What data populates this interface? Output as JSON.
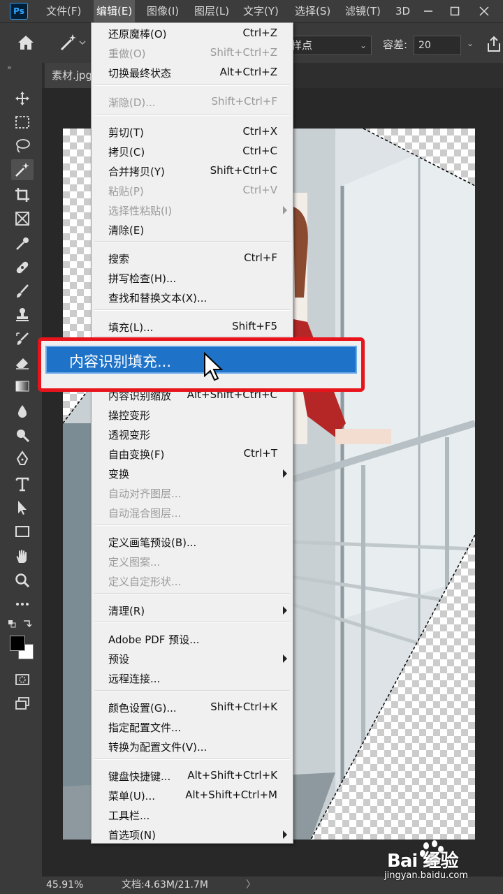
{
  "menubar": {
    "logo": "Ps",
    "items": [
      {
        "label": "文件(F)"
      },
      {
        "label": "编辑(E)"
      },
      {
        "label": "图像(I)"
      },
      {
        "label": "图层(L)"
      },
      {
        "label": "文字(Y)"
      },
      {
        "label": "选择(S)"
      },
      {
        "label": "滤镜(T)"
      },
      {
        "label": "3D"
      }
    ]
  },
  "options": {
    "sample_value": "样点",
    "tolerance_label": "容差:",
    "tolerance_value": "20"
  },
  "document": {
    "tab_label": "素材.jpg"
  },
  "edit_menu": {
    "items": [
      {
        "label": "还原魔棒(O)",
        "shortcut": "Ctrl+Z",
        "disabled": false
      },
      {
        "label": "重做(O)",
        "shortcut": "Shift+Ctrl+Z",
        "disabled": true
      },
      {
        "label": "切换最终状态",
        "shortcut": "Alt+Ctrl+Z",
        "disabled": false
      },
      {
        "label": "渐隐(D)...",
        "shortcut": "Shift+Ctrl+F",
        "disabled": true
      },
      {
        "label": "剪切(T)",
        "shortcut": "Ctrl+X",
        "disabled": false
      },
      {
        "label": "拷贝(C)",
        "shortcut": "Ctrl+C",
        "disabled": false
      },
      {
        "label": "合并拷贝(Y)",
        "shortcut": "Shift+Ctrl+C",
        "disabled": false
      },
      {
        "label": "粘贴(P)",
        "shortcut": "Ctrl+V",
        "disabled": true
      },
      {
        "label": "选择性粘贴(I)",
        "shortcut": "",
        "disabled": true,
        "submenu": true
      },
      {
        "label": "清除(E)",
        "shortcut": "",
        "disabled": false
      },
      {
        "label": "搜索",
        "shortcut": "Ctrl+F",
        "disabled": false
      },
      {
        "label": "拼写检查(H)...",
        "shortcut": "",
        "disabled": false
      },
      {
        "label": "查找和替换文本(X)...",
        "shortcut": "",
        "disabled": false
      },
      {
        "label": "填充(L)...",
        "shortcut": "Shift+F5",
        "disabled": false
      },
      {
        "label": "内容识别缩放",
        "shortcut": "Alt+Shift+Ctrl+C",
        "disabled": false
      },
      {
        "label": "操控变形",
        "shortcut": "",
        "disabled": false
      },
      {
        "label": "透视变形",
        "shortcut": "",
        "disabled": false
      },
      {
        "label": "自由变换(F)",
        "shortcut": "Ctrl+T",
        "disabled": false
      },
      {
        "label": "变换",
        "shortcut": "",
        "disabled": false,
        "submenu": true
      },
      {
        "label": "自动对齐图层...",
        "shortcut": "",
        "disabled": true
      },
      {
        "label": "自动混合图层...",
        "shortcut": "",
        "disabled": true
      },
      {
        "label": "定义画笔预设(B)...",
        "shortcut": "",
        "disabled": false
      },
      {
        "label": "定义图案...",
        "shortcut": "",
        "disabled": true
      },
      {
        "label": "定义自定形状...",
        "shortcut": "",
        "disabled": true
      },
      {
        "label": "清理(R)",
        "shortcut": "",
        "disabled": false,
        "submenu": true
      },
      {
        "label": "Adobe PDF 预设...",
        "shortcut": "",
        "disabled": false
      },
      {
        "label": "预设",
        "shortcut": "",
        "disabled": false,
        "submenu": true
      },
      {
        "label": "远程连接...",
        "shortcut": "",
        "disabled": false
      },
      {
        "label": "颜色设置(G)...",
        "shortcut": "Shift+Ctrl+K",
        "disabled": false
      },
      {
        "label": "指定配置文件...",
        "shortcut": "",
        "disabled": false
      },
      {
        "label": "转换为配置文件(V)...",
        "shortcut": "",
        "disabled": false
      },
      {
        "label": "键盘快捷键...",
        "shortcut": "Alt+Shift+Ctrl+K",
        "disabled": false
      },
      {
        "label": "菜单(U)...",
        "shortcut": "Alt+Shift+Ctrl+M",
        "disabled": false
      },
      {
        "label": "工具栏...",
        "shortcut": "",
        "disabled": false
      },
      {
        "label": "首选项(N)",
        "shortcut": "",
        "disabled": false,
        "submenu": true
      }
    ],
    "highlighted_label": "内容识别填充..."
  },
  "status": {
    "zoom": "45.91%",
    "doc_info": "文档:4.63M/21.7M",
    "arrow": "〉"
  },
  "watermark": {
    "brand": "Bai  经验",
    "url": "jingyan.baidu.com"
  },
  "colors": {
    "highlight": "#1e73c8",
    "annotation_frame": "#e8141b"
  }
}
